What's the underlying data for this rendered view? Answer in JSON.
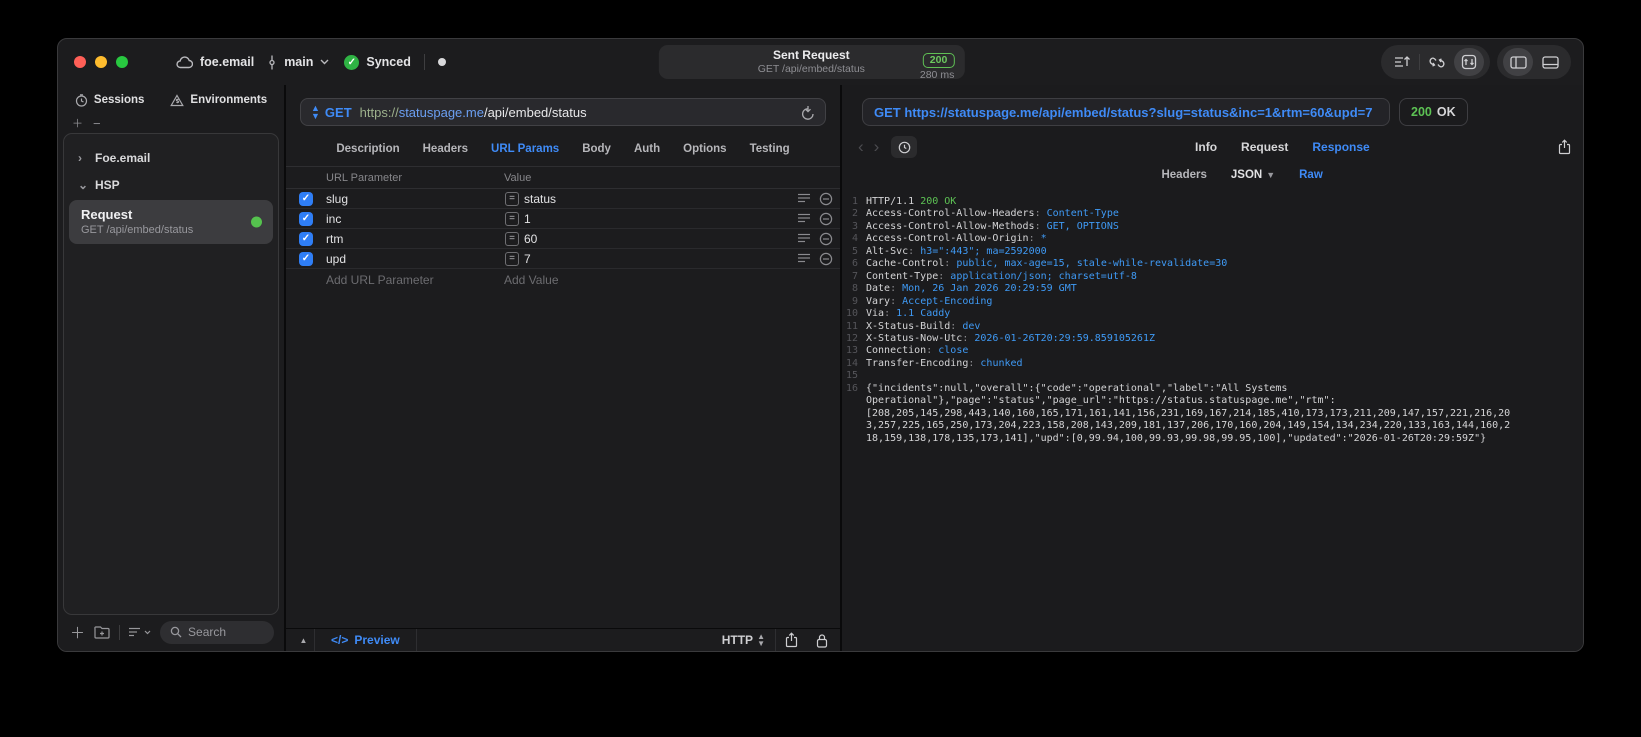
{
  "titlebar": {
    "project": "foe.email",
    "branch": "main",
    "sync_status": "Synced",
    "center": {
      "title": "Sent Request",
      "subtitle": "GET /api/embed/status",
      "status_code": "200",
      "duration": "280 ms"
    }
  },
  "sidebar": {
    "tabs": [
      {
        "label": "Sessions"
      },
      {
        "label": "Environments"
      }
    ],
    "tree": [
      {
        "label": "Foe.email",
        "chevron": "›"
      },
      {
        "label": "HSP",
        "chevron": "⌄"
      }
    ],
    "request_item": {
      "title": "Request",
      "subtitle": "GET /api/embed/status"
    },
    "search_label": "Search"
  },
  "request_pane": {
    "method": "GET",
    "url_scheme": "https://",
    "url_host": "statuspage.me",
    "url_path": "/api/embed/status",
    "tabs": [
      "Description",
      "Headers",
      "URL Params",
      "Body",
      "Auth",
      "Options",
      "Testing"
    ],
    "active_tab": "URL Params",
    "params_table": {
      "columns": {
        "param": "URL Parameter",
        "value": "Value"
      },
      "rows": [
        {
          "name": "slug",
          "value": "status",
          "enabled": true
        },
        {
          "name": "inc",
          "value": "1",
          "enabled": true
        },
        {
          "name": "rtm",
          "value": "60",
          "enabled": true
        },
        {
          "name": "upd",
          "value": "7",
          "enabled": true
        }
      ],
      "add_param_label": "Add URL Parameter",
      "add_value_label": "Add Value"
    },
    "footer": {
      "preview_icon": "</>",
      "preview_label": "Preview",
      "protocol": "HTTP"
    }
  },
  "response_pane": {
    "request_line": "GET https://statuspage.me/api/embed/status?slug=status&inc=1&rtm=60&upd=7",
    "status": {
      "code": "200",
      "text": "OK"
    },
    "tabs": [
      "Info",
      "Request",
      "Response"
    ],
    "active_tab": "Response",
    "subtabs": [
      "Headers",
      "JSON",
      "Raw"
    ],
    "active_subtab": "Raw",
    "code": {
      "status_protocol": "HTTP/1.1",
      "status_text": "200 OK",
      "headers": [
        [
          "Access-Control-Allow-Headers",
          "Content-Type"
        ],
        [
          "Access-Control-Allow-Methods",
          "GET, OPTIONS"
        ],
        [
          "Access-Control-Allow-Origin",
          "*"
        ],
        [
          "Alt-Svc",
          "h3=\":443\"; ma=2592000"
        ],
        [
          "Cache-Control",
          "public, max-age=15, stale-while-revalidate=30"
        ],
        [
          "Content-Type",
          "application/json; charset=utf-8"
        ],
        [
          "Date",
          "Mon, 26 Jan 2026 20:29:59 GMT"
        ],
        [
          "Vary",
          "Accept-Encoding"
        ],
        [
          "Via",
          "1.1 Caddy"
        ],
        [
          "X-Status-Build",
          "dev"
        ],
        [
          "X-Status-Now-Utc",
          "2026-01-26T20:29:59.859105261Z"
        ],
        [
          "Connection",
          "close"
        ],
        [
          "Transfer-Encoding",
          "chunked"
        ]
      ],
      "body": "{\"incidents\":null,\"overall\":{\"code\":\"operational\",\"label\":\"All Systems Operational\"},\"page\":\"status\",\"page_url\":\"https://status.statuspage.me\",\"rtm\":[208,205,145,298,443,140,160,165,171,161,141,156,231,169,167,214,185,410,173,173,211,209,147,157,221,216,203,257,225,165,250,173,204,223,158,208,143,209,181,137,206,170,160,204,149,154,134,234,220,133,163,144,160,218,159,138,178,135,173,141],\"upd\":[0,99.94,100,99.93,99.98,99.95,100],\"updated\":\"2026-01-26T20:29:59Z\"}"
    }
  },
  "colors": {
    "accent_blue": "#3f8bf7",
    "status_green": "#5dc254",
    "value_blue": "#3f9af5",
    "checkbox_blue": "#2f7ef6"
  },
  "icons": {
    "collapsed_chevron": "›",
    "expanded_chevron": "⌄",
    "back_chevron": "‹",
    "forward_chevron": "›",
    "up_triangle": "▲",
    "plus": "＋",
    "minus": "−",
    "equals": "="
  }
}
